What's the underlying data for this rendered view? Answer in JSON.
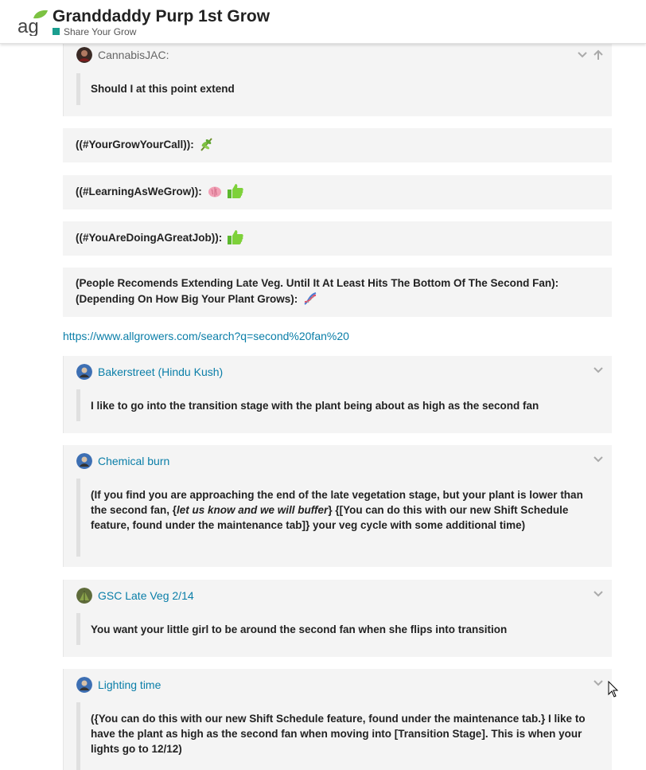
{
  "header": {
    "title": "Granddaddy Purp 1st Grow",
    "category": "Share Your Grow",
    "logo_text": "ag",
    "category_color": "#1a9e8f"
  },
  "posts": {
    "quote1": {
      "author": "CannabisJAC:",
      "text": "Should I at this point extend"
    },
    "hash1": {
      "text": "((#YourGrowYourCall)):",
      "emoji": "herb"
    },
    "hash2": {
      "text": "((#LearningAsWeGrow)):",
      "emoji": "brain, thumbs-up"
    },
    "hash3": {
      "text": "((#YouAreDoingAGreatJob)):",
      "emoji": "thumbs-up"
    },
    "hash4": {
      "line1": "(People Recomends Extending Late Veg. Until It At Least Hits The Bottom Of The Second Fan):",
      "line2": "(Depending On How Big Your Plant Grows):",
      "emoji": "dna"
    },
    "link": "https://www.allgrowers.com/search?q=second%20fan%20",
    "quote2": {
      "author": "Bakerstreet (Hindu Kush)",
      "text": "I like to go into the transition stage with the plant being about as high as the second fan"
    },
    "quote3": {
      "author": "Chemical burn",
      "text_a": "(If you find you are approaching the end of the late vegetation stage, but your plant is lower than the second fan, {",
      "text_em": "let us know and we will buffer",
      "text_b": "} {[You can do this with our new Shift Schedule feature, found under the maintenance tab]} your veg cycle with some additional time)"
    },
    "quote4": {
      "author": "GSC Late Veg 2/14",
      "text": "You want your little girl to be around the second fan when she flips into transition"
    },
    "quote5": {
      "author": "Lighting time",
      "text": "({You can do this with our new Shift Schedule feature, found under the maintenance tab.} I like to have the plant as high as the second fan when moving into [Transition Stage]. This is when your lights go to 12/12)"
    }
  },
  "colors": {
    "link": "#0a7ea8",
    "quote_bg": "#f4f4f4",
    "quote_bar": "#e0e0e0"
  }
}
